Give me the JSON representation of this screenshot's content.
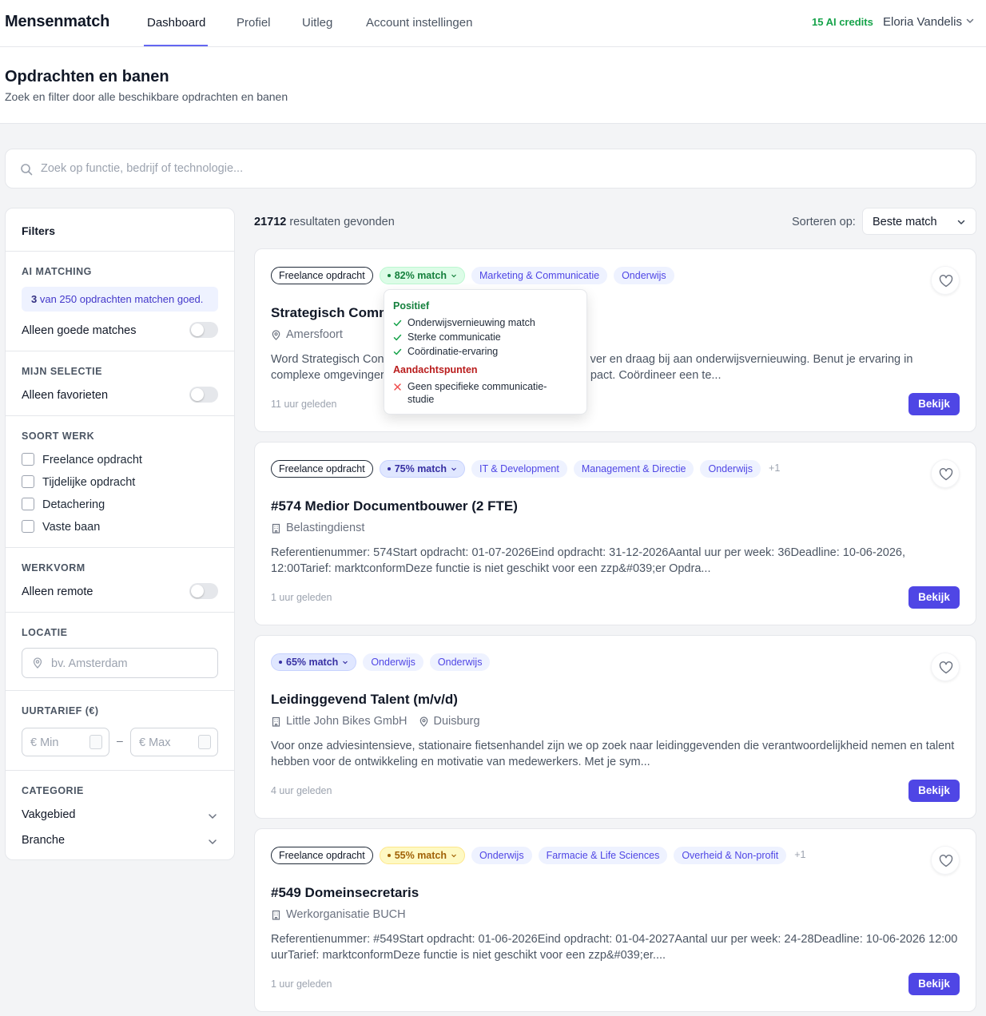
{
  "nav": {
    "brand": "Mensenmatch",
    "links": [
      "Dashboard",
      "Profiel",
      "Uitleg",
      "Account instellingen"
    ],
    "active_link": "Dashboard",
    "credits": "15 AI credits",
    "user": "Eloria Vandelis"
  },
  "header": {
    "title": "Opdrachten en banen",
    "subtitle": "Zoek en filter door alle beschikbare opdrachten en banen"
  },
  "search": {
    "placeholder": "Zoek op functie, bedrijf of technologie..."
  },
  "filters": {
    "title": "Filters",
    "ai_matching": {
      "heading": "AI MATCHING",
      "info_count": "3",
      "info_text": " van 250 opdrachten matchen goed.",
      "toggle_label": "Alleen goede matches"
    },
    "selection": {
      "heading": "MIJN SELECTIE",
      "toggle_label": "Alleen favorieten"
    },
    "work_type": {
      "heading": "SOORT WERK",
      "options": [
        "Freelance opdracht",
        "Tijdelijke opdracht",
        "Detachering",
        "Vaste baan"
      ]
    },
    "work_form": {
      "heading": "WERKVORM",
      "toggle_label": "Alleen remote"
    },
    "location": {
      "heading": "LOCATIE",
      "placeholder": "bv. Amsterdam"
    },
    "rate": {
      "heading": "UURTARIEF (€)",
      "min_placeholder": "€ Min",
      "max_placeholder": "€ Max",
      "separator": "–"
    },
    "category": {
      "heading": "CATEGORIE",
      "items": [
        "Vakgebied",
        "Branche"
      ]
    }
  },
  "results": {
    "count": "21712",
    "count_text": " resultaten gevonden",
    "sort_label": "Sorteren op:",
    "sort_value": "Beste match"
  },
  "cards": [
    {
      "type": "Freelance opdracht",
      "match": "82% match",
      "match_color": "#15803d",
      "categories": [
        "Marketing & Communicatie",
        "Onderwijs"
      ],
      "more": "",
      "title": "Strategisch Comm",
      "location": "Amersfoort",
      "desc_line1": "Word Strategisch Con",
      "desc_line1_end": "ver en draag bij aan onderwijsvernieuwing. Benut je ervaring in",
      "desc_line2": "complexe omgevinger",
      "desc_line2_end": "pact. Coördineer een te...",
      "time": "11 uur geleden",
      "button": "Bekijk"
    },
    {
      "type": "Freelance opdracht",
      "match": "75% match",
      "match_color": "#3730a3",
      "categories": [
        "IT & Development",
        "Management & Directie",
        "Onderwijs"
      ],
      "more": "+1",
      "title": "#574 Medior Documentbouwer (2 FTE)",
      "company": "Belastingdienst",
      "desc": "Referentienummer: 574Start opdracht: 01-07-2026Eind opdracht: 31-12-2026Aantal uur per week: 36Deadline: 10-06-2026, 12:00Tarief: marktconformDeze functie is niet geschikt voor een zzp&#039;er   Opdra...",
      "time": "1 uur geleden",
      "button": "Bekijk"
    },
    {
      "match": "65% match",
      "match_color": "#3730a3",
      "categories": [
        "Onderwijs",
        "Onderwijs"
      ],
      "title": "Leidinggevend Talent (m/v/d)",
      "company": "Little John Bikes GmbH",
      "location": "Duisburg",
      "desc": "Voor onze adviesintensieve, stationaire fietsenhandel zijn we op zoek naar leidinggevenden die verantwoordelijkheid nemen en talent hebben voor de ontwikkeling en motivatie van medewerkers. Met je sym...",
      "time": "4 uur geleden",
      "button": "Bekijk"
    },
    {
      "type": "Freelance opdracht",
      "match": "55% match",
      "match_color": "#a16207",
      "categories": [
        "Onderwijs",
        "Farmacie & Life Sciences",
        "Overheid & Non-profit"
      ],
      "more": "+1",
      "title": "#549 Domeinsecretaris",
      "company": "Werkorganisatie BUCH",
      "desc": "Referentienummer: #549Start opdracht: 01-06-2026Eind opdracht: 01-04-2027Aantal uur per week: 24-28Deadline: 10-06-2026 12:00 uurTarief: marktconformDeze functie is niet geschikt voor een zzp&#039;er....",
      "time": "1 uur geleden",
      "button": "Bekijk"
    }
  ],
  "popover": {
    "positive_heading": "Positief",
    "positive": [
      "Onderwijsvernieuwing match",
      "Sterke communicatie",
      "Coördinatie-ervaring"
    ],
    "attention_heading": "Aandachtspunten",
    "attention": [
      "Geen specifieke communicatie-studie"
    ]
  },
  "colors": {
    "accent": "#4f46e5",
    "credits": "#16a34a",
    "positive": "#15803d",
    "attention": "#b91c1c"
  },
  "icons": [
    "chevron-down-icon",
    "search-icon",
    "map-pin-icon",
    "building-icon",
    "heart-icon",
    "check-icon",
    "x-icon"
  ]
}
